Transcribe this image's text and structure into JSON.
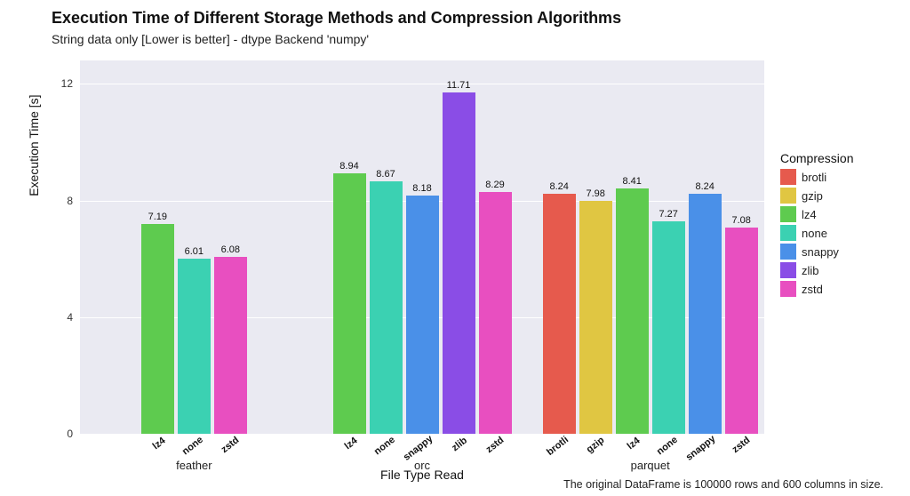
{
  "title": "Execution Time of Different Storage Methods and Compression Algorithms",
  "subtitle": "String data only [Lower is better] - dtype Backend 'numpy'",
  "ylabel": "Execution Time [s]",
  "xlabel": "File Type Read",
  "footer": "The original DataFrame is 100000 rows and 600 columns in size.",
  "legend_title": "Compression",
  "colors": {
    "brotli": "#e65a4d",
    "gzip": "#e0c642",
    "lz4": "#5ecb4f",
    "none": "#3bd1b2",
    "snappy": "#4a90e8",
    "zlib": "#8a4de6",
    "zstd": "#e84fc0"
  },
  "legend_order": [
    "brotli",
    "gzip",
    "lz4",
    "none",
    "snappy",
    "zlib",
    "zstd"
  ],
  "y_ticks": [
    0,
    4,
    8,
    12
  ],
  "y_max": 12.8,
  "chart_data": {
    "type": "bar",
    "xlabel": "File Type Read",
    "ylabel": "Execution Time [s]",
    "ylim": [
      0,
      12.8
    ],
    "title": "Execution Time of Different Storage Methods and Compression Algorithms",
    "groups": [
      {
        "name": "feather",
        "bars": [
          {
            "compression": "lz4",
            "value": 7.19
          },
          {
            "compression": "none",
            "value": 6.01
          },
          {
            "compression": "zstd",
            "value": 6.08
          }
        ]
      },
      {
        "name": "orc",
        "bars": [
          {
            "compression": "lz4",
            "value": 8.94
          },
          {
            "compression": "none",
            "value": 8.67
          },
          {
            "compression": "snappy",
            "value": 8.18
          },
          {
            "compression": "zlib",
            "value": 11.71
          },
          {
            "compression": "zstd",
            "value": 8.29
          }
        ]
      },
      {
        "name": "parquet",
        "bars": [
          {
            "compression": "brotli",
            "value": 8.24
          },
          {
            "compression": "gzip",
            "value": 7.98
          },
          {
            "compression": "lz4",
            "value": 8.41
          },
          {
            "compression": "none",
            "value": 7.27
          },
          {
            "compression": "snappy",
            "value": 8.24
          },
          {
            "compression": "zstd",
            "value": 7.08
          }
        ]
      }
    ]
  }
}
